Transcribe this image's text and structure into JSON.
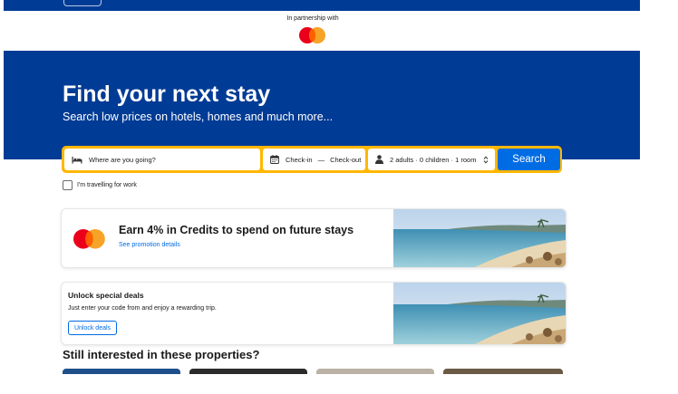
{
  "partnership": {
    "text": "In partnership with"
  },
  "hero": {
    "title": "Find your next stay",
    "subtitle": "Search low prices on hotels, homes and much more..."
  },
  "search": {
    "destination_placeholder": "Where are you going?",
    "checkin": "Check-in",
    "dash": "—",
    "checkout": "Check-out",
    "guests": "2 adults · 0 children · 1 room",
    "button": "Search",
    "work_travel": "I'm travelling for work"
  },
  "promo": {
    "title": "Earn 4% in Credits to spend on future stays",
    "link": "See promotion details"
  },
  "deals": {
    "title": "Unlock special deals",
    "text": "Just enter your code from and enjoy a rewarding trip.",
    "button": "Unlock deals"
  },
  "properties": {
    "heading": "Still interested in these properties?"
  },
  "colors": {
    "brand_blue": "#003b95",
    "search_yellow": "#ffb700",
    "action_blue": "#006ce4"
  },
  "icons": [
    "bed-icon",
    "calendar-icon",
    "person-icon",
    "updown-icon",
    "mastercard-logo"
  ]
}
